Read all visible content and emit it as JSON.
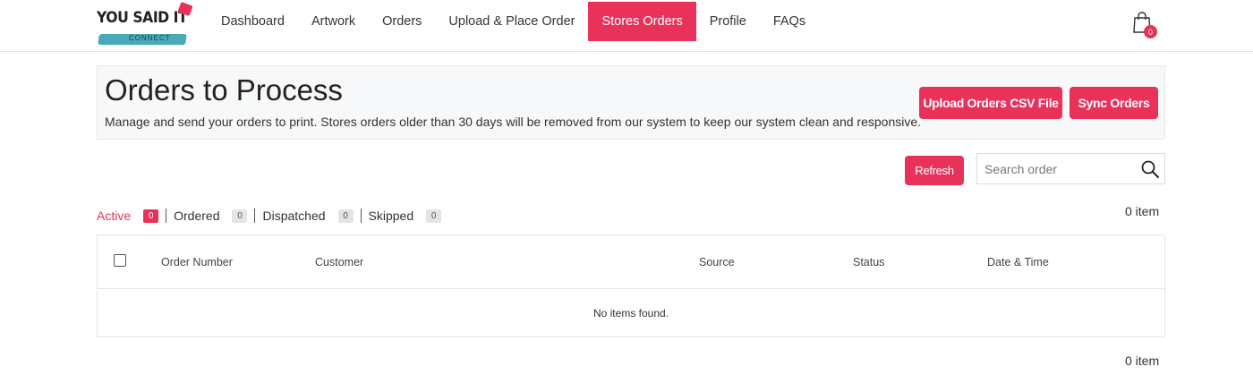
{
  "brand": {
    "logo_text": "YOU SAID IT",
    "logo_sub": "CONNECT"
  },
  "nav": {
    "items": [
      {
        "label": "Dashboard"
      },
      {
        "label": "Artwork"
      },
      {
        "label": "Orders"
      },
      {
        "label": "Upload & Place Order"
      },
      {
        "label": "Stores Orders",
        "active": true
      },
      {
        "label": "Profile"
      },
      {
        "label": "FAQs"
      }
    ],
    "cart_count": "0"
  },
  "header": {
    "title": "Orders to Process",
    "description": "Manage and send your orders to print. Stores orders older than 30 days will be removed from our system to keep our system clean and responsive.",
    "upload_label": "Upload Orders CSV File",
    "sync_label": "Sync Orders"
  },
  "toolbar": {
    "refresh_label": "Refresh",
    "search_placeholder": "Search order"
  },
  "filters": [
    {
      "label": "Active",
      "count": "0",
      "active": true
    },
    {
      "label": "Ordered",
      "count": "0"
    },
    {
      "label": "Dispatched",
      "count": "0"
    },
    {
      "label": "Skipped",
      "count": "0"
    }
  ],
  "item_count_top": "0 item",
  "item_count_bottom": "0 item",
  "table": {
    "columns": [
      "Order Number",
      "Customer",
      "Source",
      "Status",
      "Date & Time"
    ],
    "empty_message": "No items found."
  },
  "colors": {
    "accent": "#e8325a",
    "logo_stripe": "#4aa9b8"
  }
}
